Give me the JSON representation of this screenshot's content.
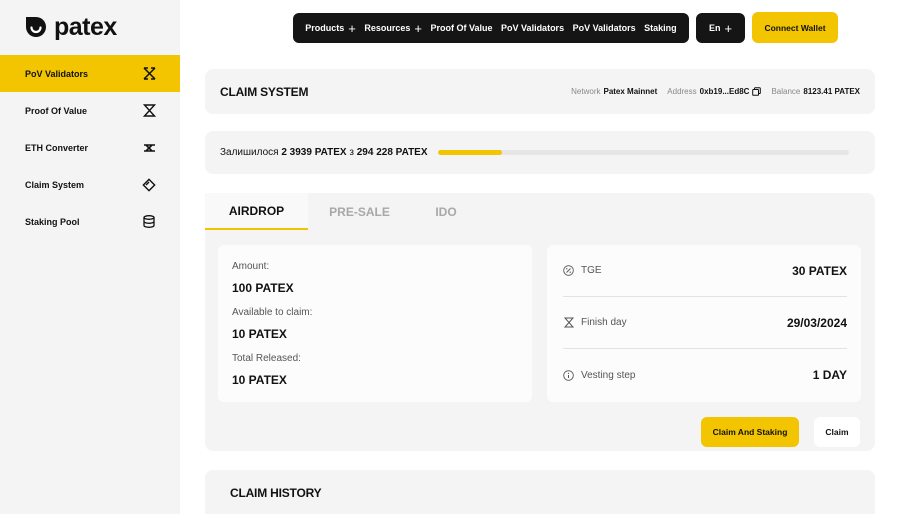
{
  "brand": {
    "name": "patex",
    "accent_color": "#f2c500",
    "dark_color": "#151515"
  },
  "sidebar": {
    "items": [
      {
        "label": "PoV Validators",
        "icon": "pov-validators-icon",
        "active": true
      },
      {
        "label": "Proof Of Value",
        "icon": "hourglass-icon",
        "active": false
      },
      {
        "label": "ETH Converter",
        "icon": "converter-icon",
        "active": false
      },
      {
        "label": "Claim System",
        "icon": "claim-ticket-icon",
        "active": false
      },
      {
        "label": "Staking Pool",
        "icon": "coin-stack-icon",
        "active": false
      }
    ]
  },
  "topnav": {
    "items": [
      {
        "label": "Products",
        "has_plus": true
      },
      {
        "label": "Resources",
        "has_plus": true
      },
      {
        "label": "Proof Of Value",
        "has_plus": false
      },
      {
        "label": "PoV Validators",
        "has_plus": false
      },
      {
        "label": "PoV Validators",
        "has_plus": false
      },
      {
        "label": "Staking",
        "has_plus": false
      }
    ],
    "lang": "En",
    "connect_label": "Connect Wallet"
  },
  "header": {
    "title": "CLAIM SYSTEM",
    "network_label": "Network",
    "network_value": "Patex Mainnet",
    "address_label": "Address",
    "address_value": "0xb19...Ed8C",
    "balance_label": "Balance",
    "balance_value": "8123.41 PATEX"
  },
  "progress": {
    "prefix": "Залишилося",
    "remaining": "2 3939 PATEX",
    "of_word": "з",
    "total": "294 228 PATEX",
    "fill_percent": 15.8
  },
  "tabs": [
    {
      "label": "AIRDROP",
      "active": true
    },
    {
      "label": "PRE-SALE",
      "active": false
    },
    {
      "label": "IDO",
      "active": false
    }
  ],
  "amounts": {
    "amount_label": "Amount:",
    "amount_value": "100 PATEX",
    "available_label": "Available to claim:",
    "available_value": "10 PATEX",
    "released_label": "Total Released:",
    "released_value": "10 PATEX"
  },
  "info": {
    "tge_label": "TGE",
    "tge_value": "30 PATEX",
    "finish_label": "Finish day",
    "finish_value": "29/03/2024",
    "vesting_label": "Vesting step",
    "vesting_value": "1 DAY"
  },
  "actions": {
    "claim_and_staking": "Claim And Staking",
    "claim": "Claim"
  },
  "history": {
    "title": "CLAIM HISTORY"
  }
}
